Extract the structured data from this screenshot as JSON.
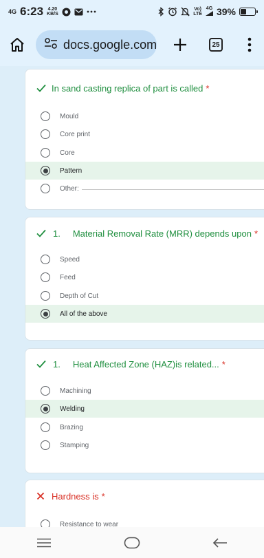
{
  "status_bar": {
    "network_type": "4G",
    "time": "6:23",
    "speed_value": "4.20",
    "speed_unit": "KB/S",
    "volte_top": "Vo)",
    "volte_bottom": "LTE",
    "network_right": "4G",
    "battery_percent": "39%",
    "battery_level": 0.39
  },
  "browser": {
    "url": "docs.google.com",
    "tab_count": "25"
  },
  "questions": [
    {
      "status": "correct",
      "number": "",
      "title": "In sand casting replica of part is called",
      "required_mark": "*",
      "options": [
        {
          "label": "Mould",
          "selected": false
        },
        {
          "label": "Core print",
          "selected": false
        },
        {
          "label": "Core",
          "selected": false
        },
        {
          "label": "Pattern",
          "selected": true
        },
        {
          "label": "Other:",
          "selected": false
        }
      ]
    },
    {
      "status": "correct",
      "number": "1.",
      "title": "Material Removal Rate (MRR) depends upon",
      "required_mark": "*",
      "options": [
        {
          "label": "Speed",
          "selected": false
        },
        {
          "label": "Feed",
          "selected": false
        },
        {
          "label": "Depth of Cut",
          "selected": false
        },
        {
          "label": "All of the above",
          "selected": true
        }
      ]
    },
    {
      "status": "correct",
      "number": "1.",
      "title": "Heat Affected Zone (HAZ)is related...",
      "required_mark": "*",
      "options": [
        {
          "label": "Machining",
          "selected": false
        },
        {
          "label": "Welding",
          "selected": true
        },
        {
          "label": "Brazing",
          "selected": false
        },
        {
          "label": "Stamping",
          "selected": false
        }
      ]
    },
    {
      "status": "incorrect",
      "number": "",
      "title": "Hardness is",
      "required_mark": "*",
      "options": [
        {
          "label": "Resistance to wear",
          "selected": false
        }
      ]
    }
  ],
  "colors": {
    "correct": "#1e8e3e",
    "incorrect": "#d93025",
    "selected_bg": "#e6f4ea",
    "page_bg": "#ddeef9"
  },
  "icons": {
    "home": "home-icon",
    "site_info": "tune-icon",
    "new_tab": "plus-icon",
    "tabs": "tab-switcher-icon",
    "menu": "more-vert-icon",
    "correct": "check-icon",
    "incorrect": "cross-icon",
    "nav_recent": "menu-lines-icon",
    "nav_home": "home-pill-icon",
    "nav_back": "back-arrow-icon"
  }
}
